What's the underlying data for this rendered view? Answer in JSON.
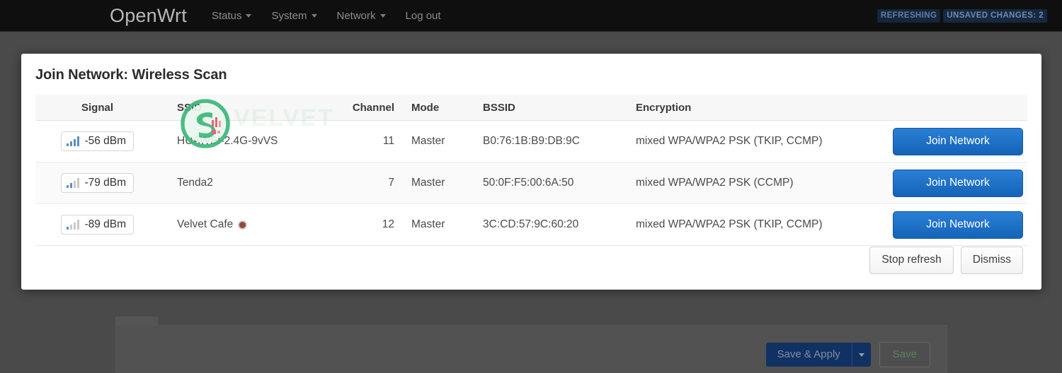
{
  "topbar": {
    "brand": "OpenWrt",
    "nav": [
      {
        "label": "Status",
        "has_caret": true
      },
      {
        "label": "System",
        "has_caret": true
      },
      {
        "label": "Network",
        "has_caret": true
      },
      {
        "label": "Log out",
        "has_caret": false
      }
    ],
    "badges": [
      {
        "label": "REFRESHING",
        "color": "#5e7fa6",
        "bg": "#15253a"
      },
      {
        "label": "UNSAVED CHANGES: 2",
        "color": "#6a8cb3",
        "bg": "#17283f"
      }
    ]
  },
  "modal": {
    "title": "Join Network: Wireless Scan",
    "columns": [
      "Signal",
      "SSID",
      "Channel",
      "Mode",
      "BSSID",
      "Encryption"
    ],
    "rows": [
      {
        "signal": "-56 dBm",
        "signal_bars_on": 4,
        "ssid": "HUAWEI-2.4G-9vVS",
        "locked": false,
        "channel": "11",
        "mode": "Master",
        "bssid": "B0:76:1B:B9:DB:9C",
        "encryption": "mixed WPA/WPA2 PSK (TKIP, CCMP)",
        "action": "Join Network"
      },
      {
        "signal": "-79 dBm",
        "signal_bars_on": 2,
        "ssid": "Tenda2",
        "locked": false,
        "channel": "7",
        "mode": "Master",
        "bssid": "50:0F:F5:00:6A:50",
        "encryption": "mixed WPA/WPA2 PSK (CCMP)",
        "action": "Join Network"
      },
      {
        "signal": "-89 dBm",
        "signal_bars_on": 1,
        "ssid": "Velvet Cafe",
        "locked": true,
        "lock_icon": "lock-dot-icon",
        "channel": "12",
        "mode": "Master",
        "bssid": "3C:CD:57:9C:60:20",
        "encryption": "mixed WPA/WPA2 PSK (TKIP, CCMP)",
        "action": "Join Network"
      }
    ],
    "footer": {
      "stop_refresh": "Stop refresh",
      "dismiss": "Dismiss"
    }
  },
  "background": {
    "save_apply": "Save & Apply",
    "save": "Save",
    "caret_icon": "chevron-down-icon"
  },
  "watermark": {
    "icon": "green-circle-s-signal-logo",
    "ghost_text": "VELVET",
    "accent": "#3cb878"
  },
  "colors": {
    "page_backdrop": "#4a4a4a",
    "topbar": "#0f0f10",
    "modal_bg": "#ffffff",
    "join_button": "#1464b8",
    "signal_bar_on": "#5b8fc4",
    "signal_bar_off": "#c9c9c9"
  }
}
